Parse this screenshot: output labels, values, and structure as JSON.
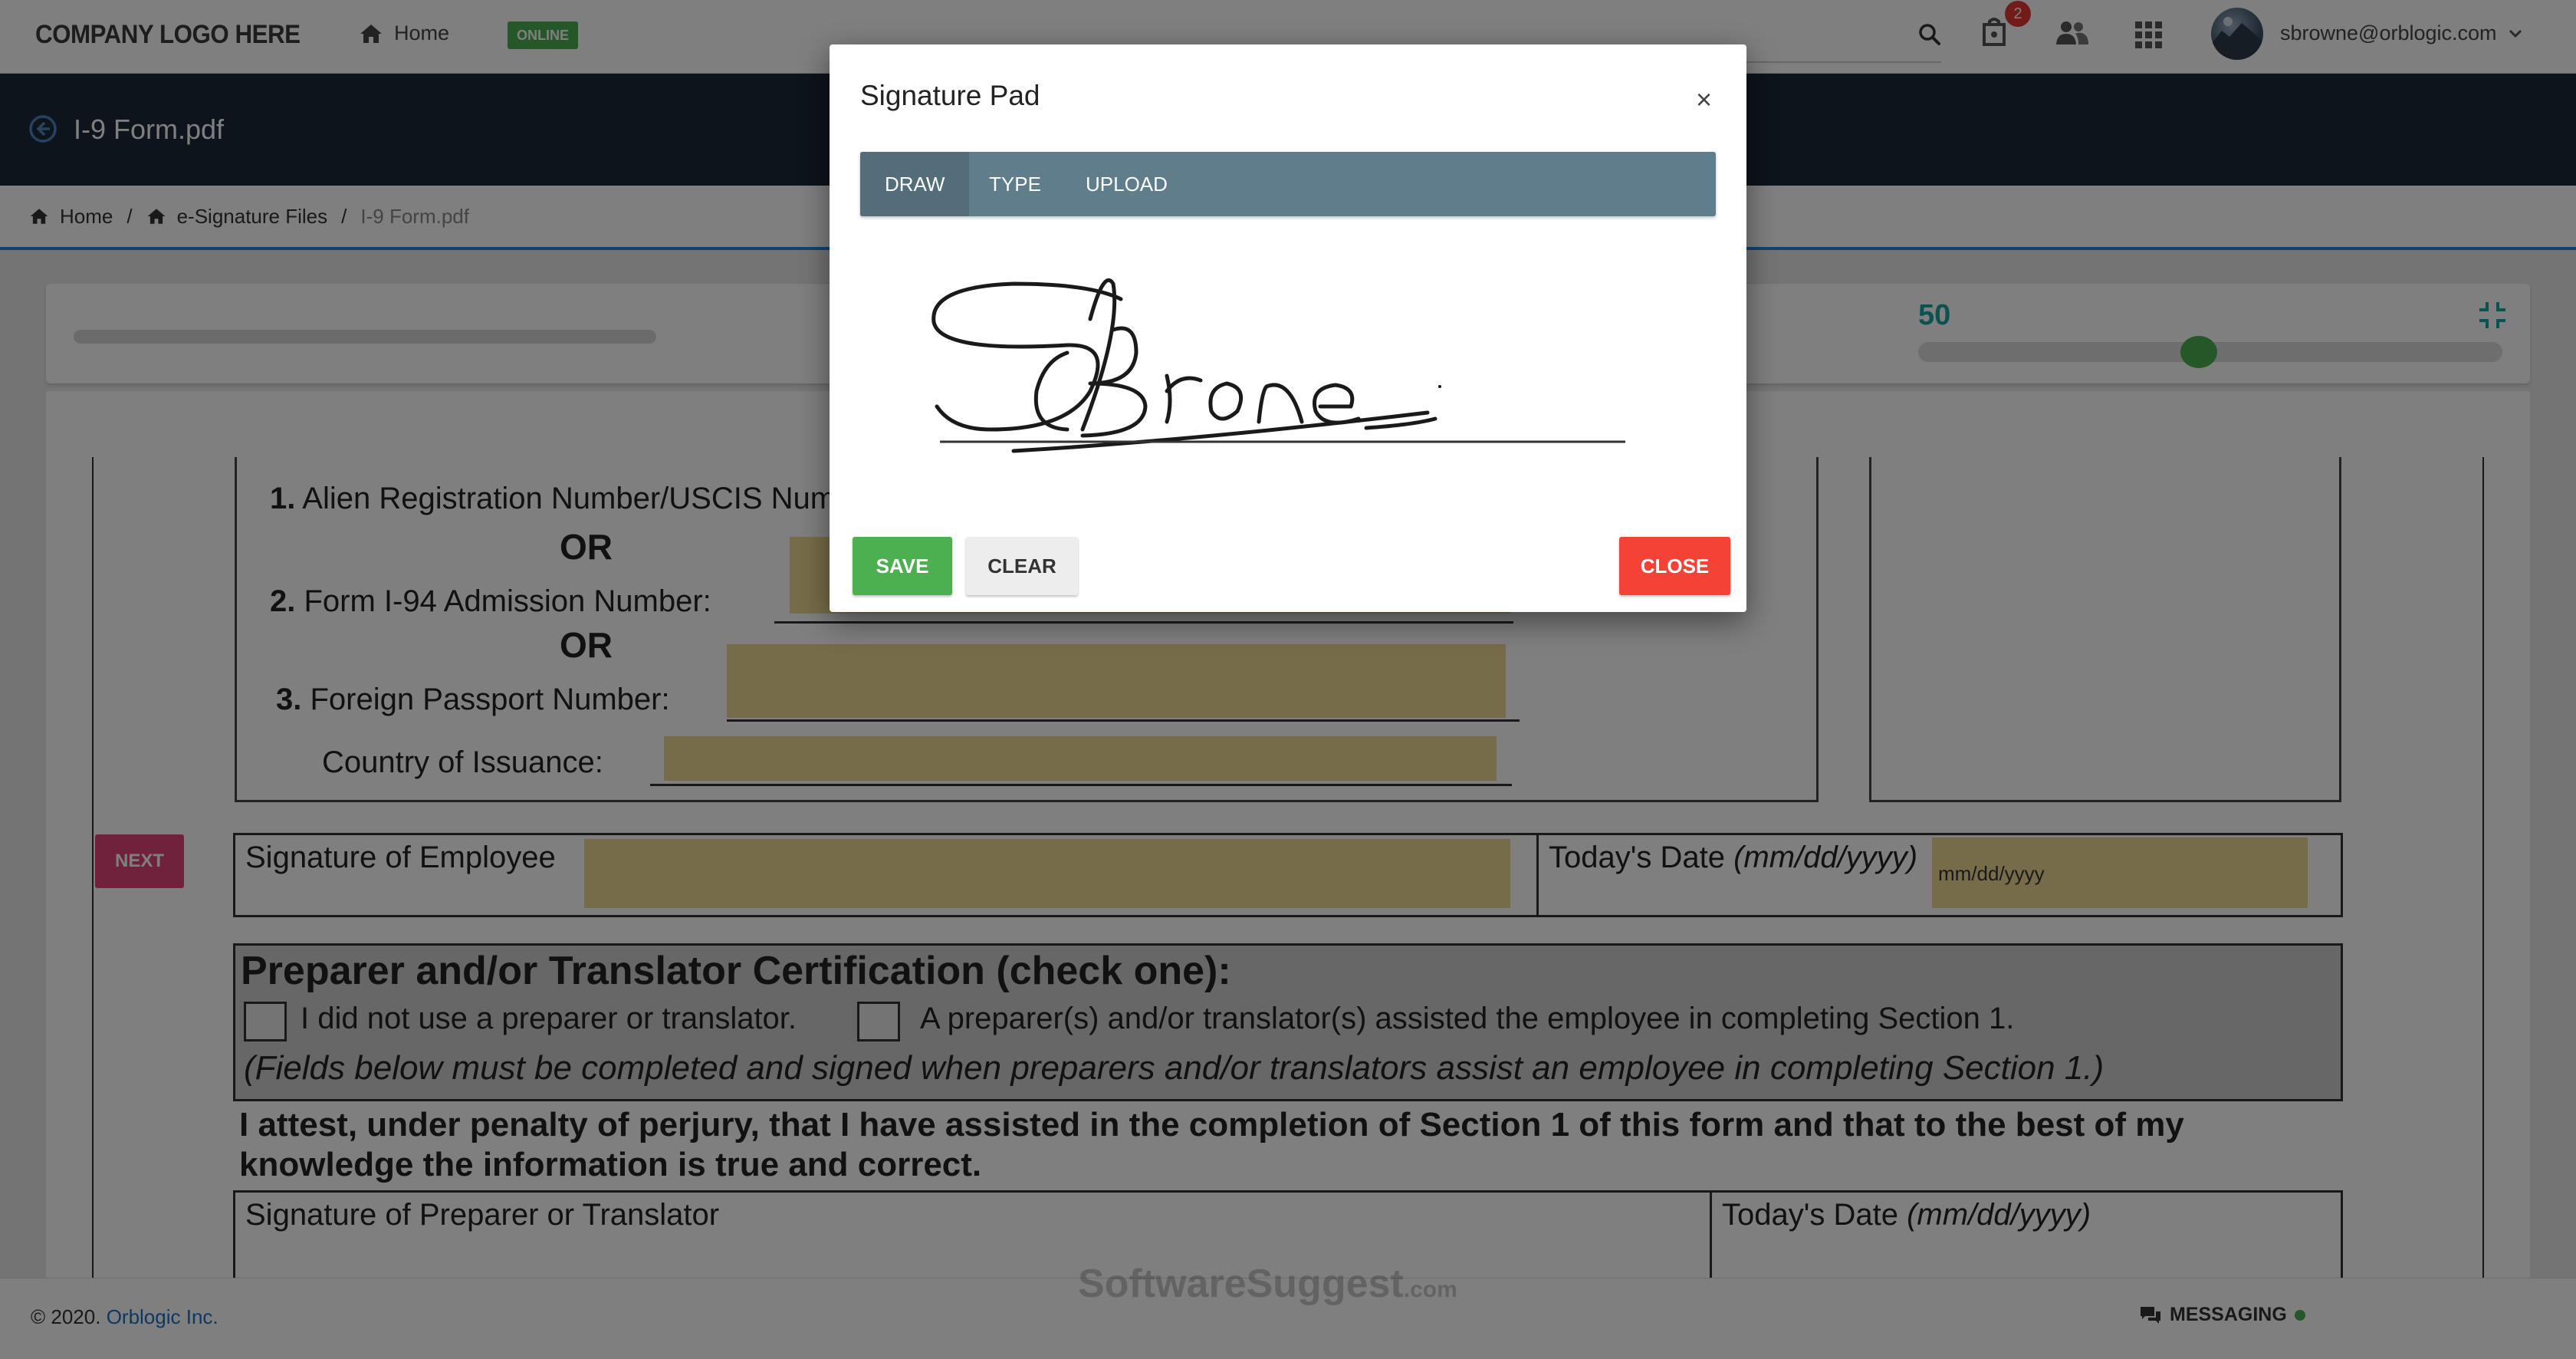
{
  "topbar": {
    "logo": "COMPANY LOGO HERE",
    "home_label": "Home",
    "status_badge": "ONLINE",
    "notification_count": "2",
    "user_email": "sbrowne@orblogic.com"
  },
  "document": {
    "title": "I-9 Form.pdf"
  },
  "breadcrumb": {
    "items": [
      "Home",
      "e-Signature Files",
      "I-9 Form.pdf"
    ]
  },
  "viewer": {
    "zoom_value": "50",
    "zoom_level_fraction": 0.48,
    "next_button": "NEXT"
  },
  "form": {
    "alien_reg": {
      "num": "1.",
      "label": "Alien Registration Number/USCIS Num"
    },
    "or1": "OR",
    "i94": {
      "num": "2.",
      "label": "Form I-94 Admission Number:"
    },
    "or2": "OR",
    "passport": {
      "num": "3.",
      "label": "Foreign Passport Number:"
    },
    "country_label": "Country of Issuance:",
    "signature_employee_label": "Signature of Employee",
    "todays_date_label": "Today's Date",
    "date_format": "(mm/dd/yyyy)",
    "date_placeholder": "mm/dd/yyyy",
    "preparer_heading": "Preparer and/or Translator Certification (check one):",
    "option_no_preparer": "I did not use a preparer or translator.",
    "option_preparer": "A preparer(s) and/or translator(s) assisted the employee in completing Section 1.",
    "preparer_note": "(Fields below must be completed and signed when preparers and/or translators assist an employee in completing Section 1.)",
    "attest_line1": "I attest, under penalty of perjury, that I have assisted in the completion of Section 1 of this form and that to the best of my",
    "attest_line2": "knowledge the information is true and correct.",
    "signature_preparer_label": "Signature of Preparer or Translator",
    "todays_date_label2": "Today's Date",
    "date_format2": "(mm/dd/yyyy)"
  },
  "modal": {
    "title": "Signature Pad",
    "close_symbol": "×",
    "tabs": [
      {
        "label": "DRAW",
        "active": true
      },
      {
        "label": "TYPE",
        "active": false
      },
      {
        "label": "UPLOAD",
        "active": false
      }
    ],
    "save_label": "SAVE",
    "clear_label": "CLEAR",
    "close_label": "CLOSE"
  },
  "footer": {
    "copyright_prefix": "© 2020.",
    "company_link": "Orblogic Inc.",
    "messaging_label": "MESSAGING",
    "watermark_main": "SoftwareSuggest",
    "watermark_suffix": ".com"
  },
  "colors": {
    "header_dark": "#1d2839",
    "accent_blue": "#1e88e5",
    "tab_bar": "#607d8b",
    "save_green": "#4caf50",
    "close_red": "#f44336",
    "next_pink": "#e0457b",
    "field_highlight": "#efd993",
    "zoom_teal": "#1aa3a3"
  }
}
